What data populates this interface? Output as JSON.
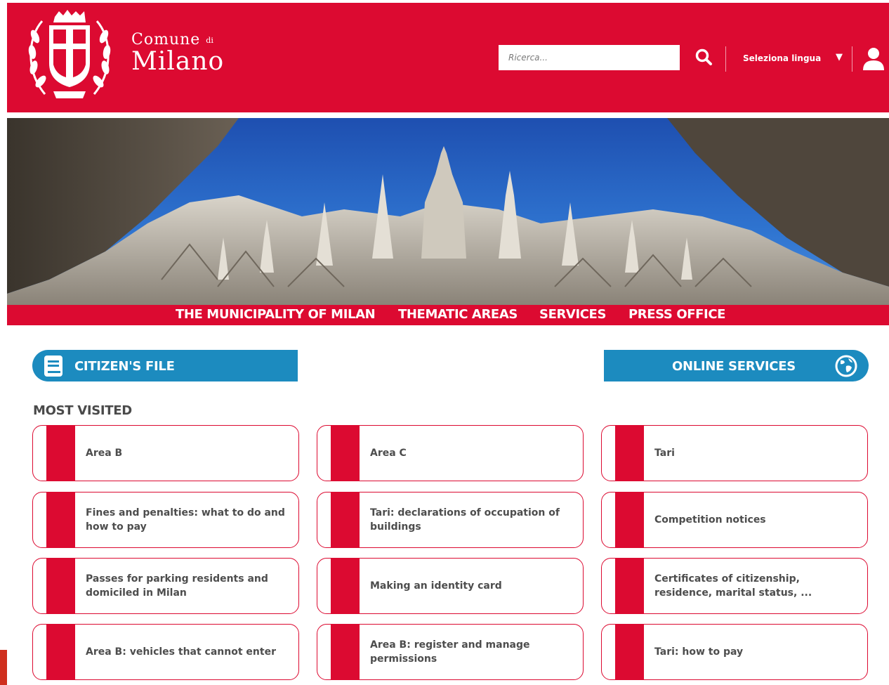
{
  "header": {
    "logo": {
      "line1": "Comune",
      "line1_small": "di",
      "line2": "Milano"
    },
    "search": {
      "placeholder": "Ricerca..."
    },
    "language": {
      "label": "Seleziona lingua"
    }
  },
  "icons": {
    "crest": "coat-of-arms",
    "search": "search-icon",
    "caret": "caret-down-icon",
    "user": "user-icon",
    "book": "book-icon",
    "globe": "globe-icon"
  },
  "colors": {
    "brand_red": "#dc0a31",
    "feature_blue": "#1c8bbf",
    "card_text": "#4d4d4d"
  },
  "nav": {
    "items": [
      {
        "label": "THE MUNICIPALITY OF MILAN"
      },
      {
        "label": "THEMATIC AREAS"
      },
      {
        "label": "SERVICES"
      },
      {
        "label": "PRESS OFFICE"
      }
    ]
  },
  "features": {
    "citizen_file": "CITIZEN'S FILE",
    "online_services": "ONLINE SERVICES"
  },
  "most_visited": {
    "title": "MOST VISITED",
    "items": [
      {
        "label": "Area B"
      },
      {
        "label": "Area C"
      },
      {
        "label": "Tari"
      },
      {
        "label": "Fines and penalties: what to do and how to pay"
      },
      {
        "label": "Tari: declarations of occupation of buildings"
      },
      {
        "label": "Competition notices"
      },
      {
        "label": "Passes for parking residents and domiciled in Milan"
      },
      {
        "label": "Making an identity card"
      },
      {
        "label": "Certificates of citizenship, residence, marital status, ..."
      },
      {
        "label": "Area B: vehicles that cannot enter"
      },
      {
        "label": "Area B: register and manage permissions"
      },
      {
        "label": "Tari: how to pay"
      }
    ]
  }
}
